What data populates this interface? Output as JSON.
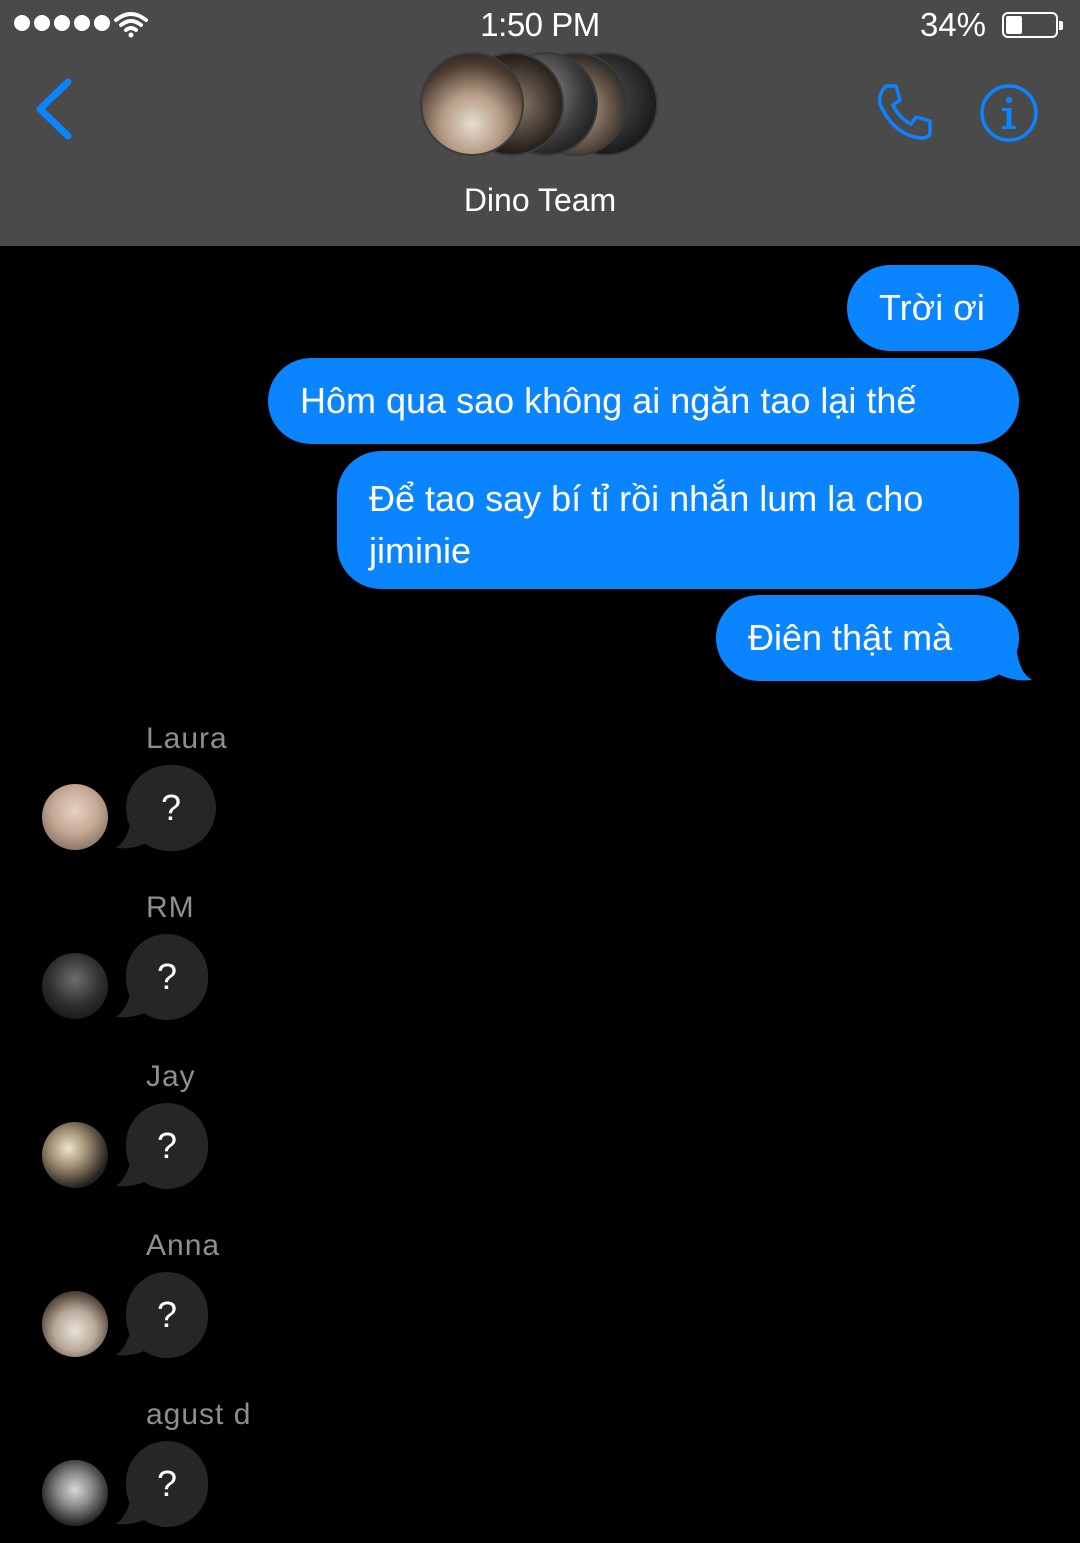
{
  "status_bar": {
    "time": "1:50 PM",
    "battery_percent": "34%",
    "battery_level": 0.34,
    "signal_dots": 5
  },
  "header": {
    "title": "Dino Team",
    "back_icon": "chevron-left-icon",
    "call_icon": "phone-icon",
    "info_icon": "info-icon"
  },
  "colors": {
    "accent": "#0a84ff",
    "header_bg": "#4a4a4a",
    "incoming_bubble": "#262626",
    "sender_name": "#8e8e93"
  },
  "outgoing": [
    {
      "text": "Trời ơi"
    },
    {
      "text": "Hôm qua sao không ai ngăn tao lại thế"
    },
    {
      "text": "Để tao say bí tỉ rồi nhắn lum la cho jiminie"
    },
    {
      "text": "Điên thật mà"
    }
  ],
  "incoming": [
    {
      "sender": "Laura",
      "text": "?"
    },
    {
      "sender": "RM",
      "text": "?"
    },
    {
      "sender": "Jay",
      "text": "?"
    },
    {
      "sender": "Anna",
      "text": "?"
    },
    {
      "sender": "agust d",
      "text": "?"
    }
  ]
}
